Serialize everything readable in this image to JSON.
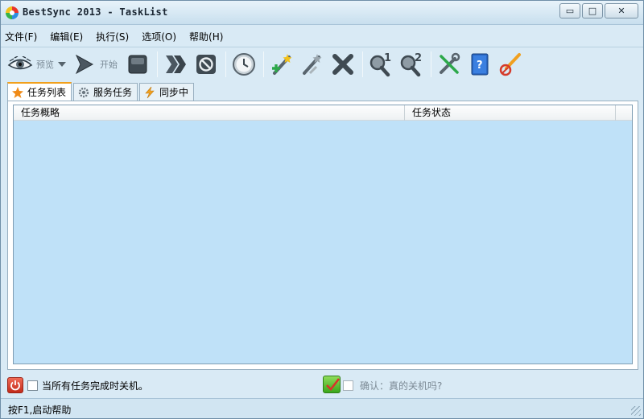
{
  "window": {
    "title": "BestSync 2013 - TaskList",
    "controls": {
      "minimize": "▭",
      "maximize": "□",
      "close": "✕"
    }
  },
  "menu": [
    {
      "label": "文件(F)"
    },
    {
      "label": "编辑(E)"
    },
    {
      "label": "执行(S)"
    },
    {
      "label": "选项(O)"
    },
    {
      "label": "帮助(H)"
    }
  ],
  "toolbar": {
    "preview_label": "预览",
    "start_label": "开始"
  },
  "tabs": [
    {
      "label": "任务列表",
      "icon": "star-icon"
    },
    {
      "label": "服务任务",
      "icon": "gear-icon"
    },
    {
      "label": "同步中",
      "icon": "lightning-icon"
    }
  ],
  "list": {
    "columns": [
      "任务概略",
      "任务状态"
    ],
    "rows": []
  },
  "footer": {
    "shutdown_label": "当所有任务完成时关机。",
    "confirm_label": "确认：真的关机吗?"
  },
  "status": {
    "text": "按F1,启动帮助"
  },
  "colors": {
    "list_bg": "#bfe1f8",
    "tab_accent": "#f1a01c",
    "power": "#d23a26",
    "confirm": "#4db226"
  }
}
